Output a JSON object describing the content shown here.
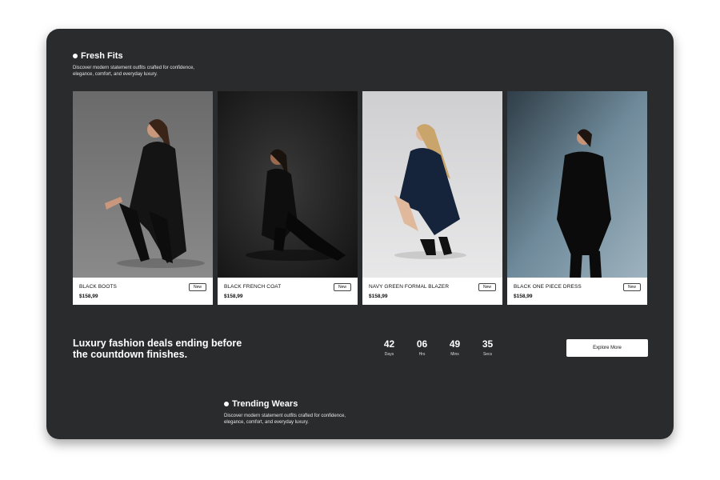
{
  "fresh_fits": {
    "title": "Fresh Fits",
    "subtitle": "Discover modern statement outfits crafted for confidence, elegance, comfort, and everyday luxury."
  },
  "products": [
    {
      "name": "BLACK BOOTS",
      "price": "$158,99",
      "badge": "New",
      "bg": "#6e6e6e"
    },
    {
      "name": "BLACK FRENCH COAT",
      "price": "$158,99",
      "badge": "New",
      "bg": "#2b2b2b"
    },
    {
      "name": "NAVY GREEN FORMAL BLAZER",
      "price": "$158,99",
      "badge": "New",
      "bg": "#dcdcdc"
    },
    {
      "name": "BLACK ONE PIECE DRESS",
      "price": "$158,99",
      "badge": "New",
      "bg": "#4f6a78"
    }
  ],
  "deal": {
    "text": "Luxury fashion deals ending before the countdown finishes.",
    "countdown": [
      {
        "value": "42",
        "label": "Days"
      },
      {
        "value": "06",
        "label": "Hrs"
      },
      {
        "value": "49",
        "label": "Mins"
      },
      {
        "value": "35",
        "label": "Secs"
      }
    ],
    "button_label": "Explore More"
  },
  "trending": {
    "title": "Trending Wears",
    "subtitle": "Discover modern statement outfits crafted for confidence, elegance, comfort, and everyday luxury."
  },
  "colors": {
    "panel": "#2a2b2d",
    "page": "#ffffff",
    "card": "#ffffff"
  }
}
